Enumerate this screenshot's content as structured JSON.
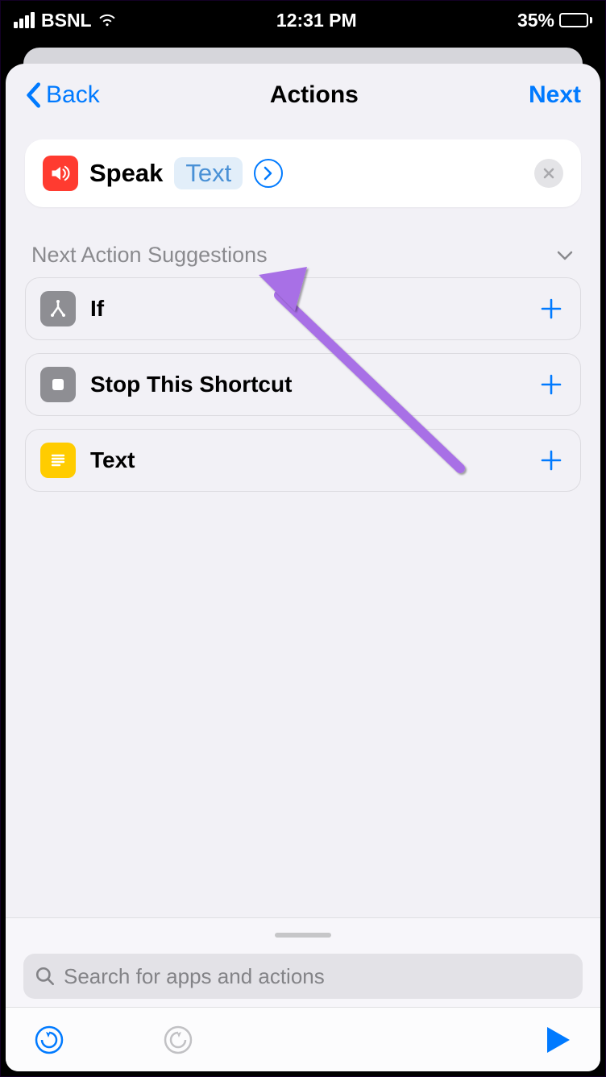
{
  "status": {
    "carrier": "BSNL",
    "time": "12:31 PM",
    "battery_percent": "35%",
    "battery_fill_pct": 35
  },
  "nav": {
    "back_label": "Back",
    "title": "Actions",
    "next_label": "Next"
  },
  "action_card": {
    "name": "Speak",
    "param_chip": "Text"
  },
  "section": {
    "title": "Next Action Suggestions"
  },
  "suggestions": [
    {
      "label": "If",
      "icon": "branch",
      "color": "gray"
    },
    {
      "label": "Stop This Shortcut",
      "icon": "stop",
      "color": "gray"
    },
    {
      "label": "Text",
      "icon": "lines",
      "color": "yellow"
    }
  ],
  "search": {
    "placeholder": "Search for apps and actions"
  }
}
